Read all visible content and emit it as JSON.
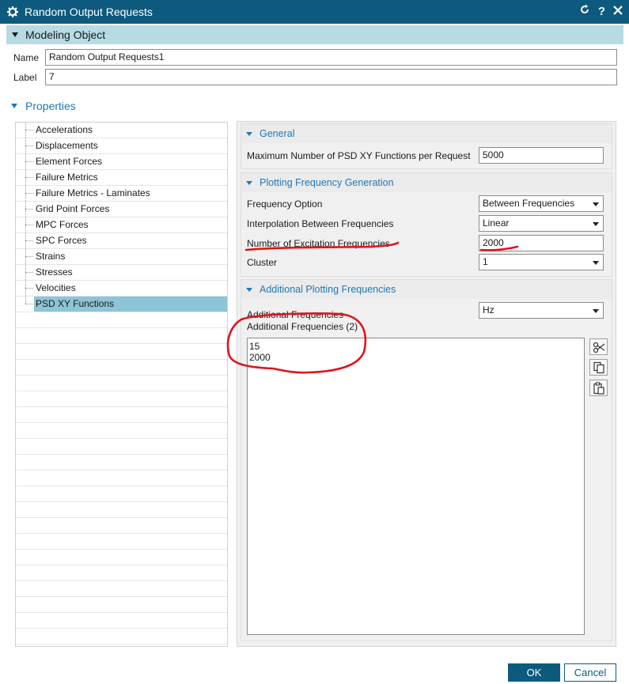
{
  "window": {
    "title": "Random Output Requests",
    "icon": "gear-icon"
  },
  "modeling_object": {
    "header": "Modeling Object",
    "name_label": "Name",
    "name_value": "Random Output Requests1",
    "label_label": "Label",
    "label_value": "7"
  },
  "properties": {
    "header": "Properties",
    "tree_items": [
      "Accelerations",
      "Displacements",
      "Element Forces",
      "Failure Metrics",
      "Failure Metrics - Laminates",
      "Grid Point Forces",
      "MPC Forces",
      "SPC Forces",
      "Strains",
      "Stresses",
      "Velocities",
      "PSD XY Functions"
    ],
    "selected_item": "PSD XY Functions"
  },
  "general": {
    "header": "General",
    "max_psd_label": "Maximum Number of PSD XY Functions per Request",
    "max_psd_value": "5000"
  },
  "plotting_generation": {
    "header": "Plotting Frequency Generation",
    "frequency_option_label": "Frequency Option",
    "frequency_option_value": "Between Frequencies",
    "interpolation_label": "Interpolation Between Frequencies",
    "interpolation_value": "Linear",
    "num_excitation_label": "Number of Excitation Frequencies",
    "num_excitation_value": "2000",
    "cluster_label": "Cluster",
    "cluster_value": "1"
  },
  "additional_plotting": {
    "header": "Additional Plotting Frequencies",
    "additional_label": "Additional Frequencies",
    "unit_value": "Hz",
    "list_label": "Additional Frequencies (2)",
    "list_values": [
      "15",
      "2000"
    ]
  },
  "buttons": {
    "ok": "OK",
    "cancel": "Cancel"
  },
  "colors": {
    "titlebar": "#0e5a7e",
    "section_bar": "#b6dbe5",
    "accent_blue": "#1f78b4",
    "selection": "#8cc5d6",
    "annotation_red": "#e0141b"
  }
}
